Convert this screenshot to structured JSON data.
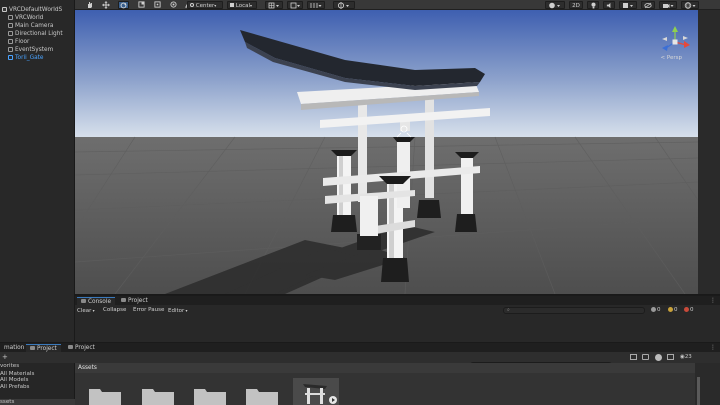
{
  "hierarchy": {
    "root": "VRCDefaultWorldS",
    "items": [
      "VRCWorld",
      "Main Camera",
      "Directional Light",
      "Floor",
      "EventSystem",
      "Torii_Gate"
    ],
    "selected_index": 5
  },
  "toolbar": {
    "pivot_label": "Center",
    "space_label": "Local",
    "mode_2d": "2D"
  },
  "scene": {
    "gizmo_label": "< Persp"
  },
  "console": {
    "tabs": [
      "Console",
      "Project"
    ],
    "clear_label": "Clear",
    "collapse_label": "Collapse",
    "error_pause_label": "Error Pause",
    "editor_label": "Editor",
    "search_placeholder": "",
    "counts": {
      "logs": "0",
      "warnings": "0",
      "errors": "0"
    }
  },
  "project": {
    "tabs": [
      "mation",
      "Project",
      "Project"
    ],
    "favorites_title": "vorites",
    "favorites": [
      "All Materials",
      "All Models",
      "All Prefabs"
    ],
    "assets_section": "ssets",
    "assets_header": "Assets",
    "count_badge": "23"
  },
  "colors": {
    "accent_selected": "#4aa3ff",
    "sky_top": "#3e5fb0",
    "sky_horizon": "#d8e1ec",
    "ground": "#565656",
    "roof": "#23272f"
  }
}
